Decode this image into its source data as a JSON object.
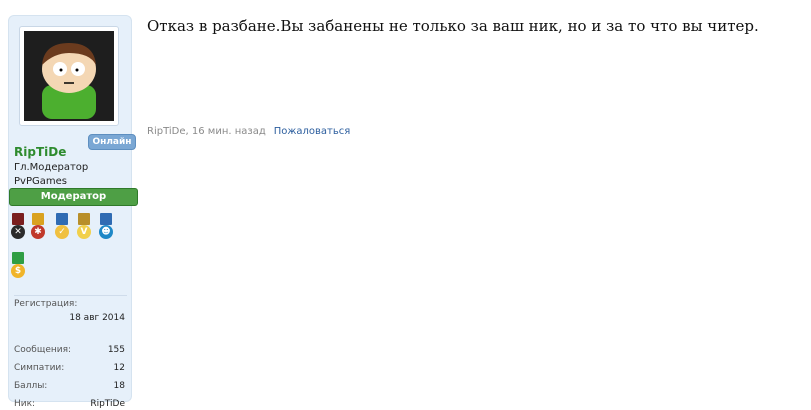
{
  "user": {
    "status_badge": "Онлайн",
    "username": "RipTiDe",
    "title": "Гл.Модератор",
    "project": "PvPGames",
    "role_banner": "Модератор",
    "avatar_icon": "cartoon-character-avatar",
    "medals": [
      {
        "icon": "crossed-swords-medal-icon",
        "ribbon": "#7a1f1f",
        "disc": "#2b2b2b",
        "glyph": "✕"
      },
      {
        "icon": "red-gear-medal-icon",
        "ribbon": "#d9a21f",
        "disc": "#c0392b",
        "glyph": "✱"
      },
      {
        "icon": "check-medal-icon",
        "ribbon": "#2f6bb3",
        "disc": "#f0c040",
        "glyph": "✓"
      },
      {
        "icon": "vip-medal-icon",
        "ribbon": "#b88f2a",
        "disc": "#f1d04b",
        "glyph": "V"
      },
      {
        "icon": "skull-medal-icon",
        "ribbon": "#2f6bb3",
        "disc": "#1e88c7",
        "glyph": "☻"
      },
      {
        "icon": "gold-coin-medal-icon",
        "ribbon": "#2f9e44",
        "disc": "#f0b429",
        "glyph": "$"
      }
    ]
  },
  "stats": [
    {
      "label": "Регистрация:",
      "value": "18 авг 2014"
    },
    {
      "label": "Сообщения:",
      "value": "155"
    },
    {
      "label": "Симпатии:",
      "value": "12"
    },
    {
      "label": "Баллы:",
      "value": "18"
    },
    {
      "label": "Ник:",
      "value": "RipTiDe"
    }
  ],
  "post": {
    "message": "Отказ в разбане.Вы забанены не только за ваш ник, но и за то что вы читер.",
    "author": "RipTiDe",
    "time": "16 мин. назад",
    "report_link": "Пожаловаться"
  },
  "colors": {
    "username": "#2e8b2e",
    "role_banner": "#4e9f45",
    "online_badge": "#7aa7d4",
    "link": "#2c5e9e"
  }
}
